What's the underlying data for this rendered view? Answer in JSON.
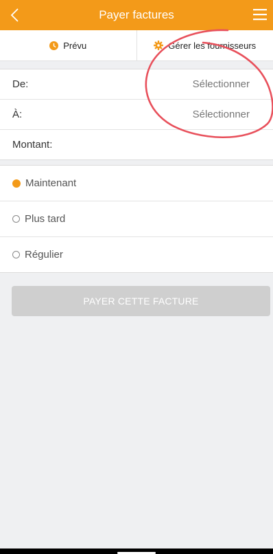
{
  "header": {
    "title": "Payer factures",
    "back_icon": "chevron-left-icon",
    "menu_icon": "hamburger-menu-icon",
    "color": "#f39a19"
  },
  "tabs": [
    {
      "label": "Prévu",
      "icon": "clock-icon"
    },
    {
      "label": "Gérer les fournisseurs",
      "icon": "gear-icon"
    }
  ],
  "form": {
    "from_label": "De:",
    "from_value": "Sélectionner",
    "to_label": "À:",
    "to_value": "Sélectionner",
    "amount_label": "Montant:"
  },
  "timing": {
    "options": [
      {
        "label": "Maintenant",
        "selected": true
      },
      {
        "label": "Plus tard",
        "selected": false
      },
      {
        "label": "Régulier",
        "selected": false
      }
    ]
  },
  "pay_button": {
    "label": "PAYER CETTE FACTURE"
  },
  "colors": {
    "accent": "#f39a19",
    "annotation": "#e8505b",
    "background": "#eff0f2"
  }
}
